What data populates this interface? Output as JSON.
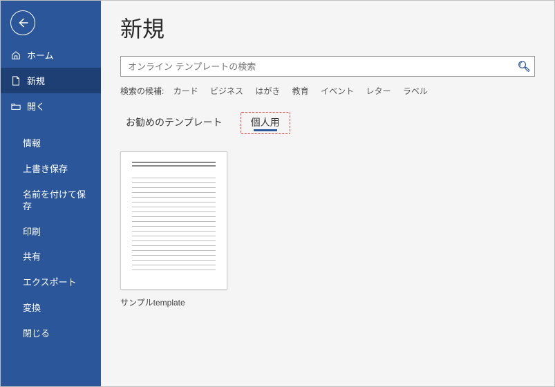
{
  "sidebar": {
    "home": "ホーム",
    "new": "新規",
    "open": "開く",
    "sub": {
      "info": "情報",
      "save": "上書き保存",
      "saveas": "名前を付けて保存",
      "print": "印刷",
      "share": "共有",
      "export": "エクスポート",
      "convert": "変換",
      "close": "閉じる"
    }
  },
  "main": {
    "title": "新規",
    "search_placeholder": "オンライン テンプレートの検索",
    "suggestions_label": "検索の候補:",
    "suggestions": {
      "card": "カード",
      "business": "ビジネス",
      "postcard": "はがき",
      "education": "教育",
      "event": "イベント",
      "letter": "レター",
      "label": "ラベル"
    },
    "tabs": {
      "recommended": "お勧めのテンプレート",
      "personal": "個人用"
    },
    "template": {
      "sample_label": "サンプルtemplate"
    }
  }
}
